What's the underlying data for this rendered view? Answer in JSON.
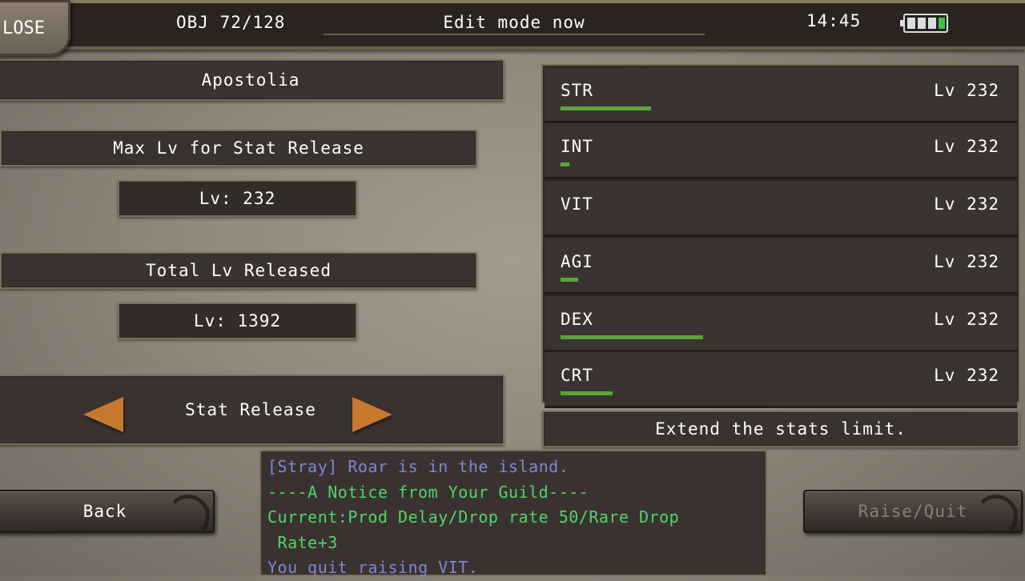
{
  "topbar": {
    "close_label": "LOSE",
    "obj_counter": "OBJ 72/128",
    "mode_text": "Edit mode now",
    "clock": "14:45",
    "battery_icon": "battery-icon"
  },
  "left": {
    "character_name": "Apostolia",
    "max_lv_title": "Max Lv for Stat Release",
    "max_lv_value": "Lv: 232",
    "total_title": "Total Lv Released",
    "total_value": "Lv: 1392",
    "selector_label": "Stat Release"
  },
  "stats": [
    {
      "name": "STR",
      "level": "Lv 232",
      "bar_fraction": 0.21
    },
    {
      "name": "INT",
      "level": "Lv 232",
      "bar_fraction": 0.02
    },
    {
      "name": "VIT",
      "level": "Lv 232",
      "bar_fraction": 0
    },
    {
      "name": "AGI",
      "level": "Lv 232",
      "bar_fraction": 0.04
    },
    {
      "name": "DEX",
      "level": "Lv 232",
      "bar_fraction": 0.33
    },
    {
      "name": "CRT",
      "level": "Lv 232",
      "bar_fraction": 0.12
    }
  ],
  "description": "Extend the stats limit.",
  "chat": [
    {
      "text": "[Stray] Roar is in the island.",
      "color": "#7f86d6"
    },
    {
      "text": "----A Notice from Your Guild----",
      "color": "#4fd66a"
    },
    {
      "text": "Current:Prod Delay/Drop rate 50/Rare Drop",
      "color": "#4fd66a"
    },
    {
      "text": " Rate+3",
      "color": "#4fd66a"
    },
    {
      "text": "You quit raising VIT.",
      "color": "#7f86d6"
    }
  ],
  "buttons": {
    "back": "Back",
    "raise_quit": "Raise/Quit",
    "raise_quit_color": "#8a7f78"
  }
}
